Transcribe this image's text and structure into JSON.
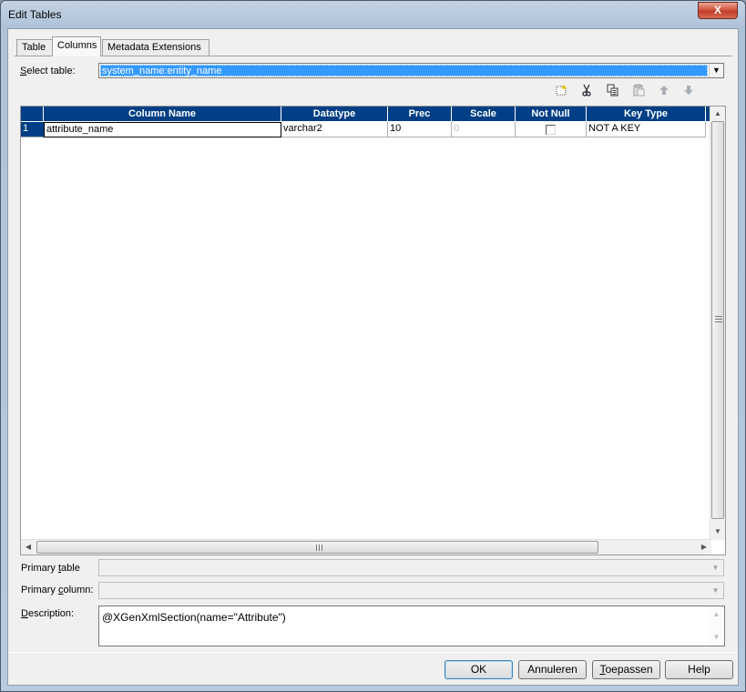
{
  "window": {
    "title": "Edit Tables",
    "close_label": "X"
  },
  "tabs": [
    {
      "label": "Table"
    },
    {
      "label": "Columns"
    },
    {
      "label": "Metadata Extensions"
    }
  ],
  "select_table": {
    "label_prefix": "S",
    "label_rest": "elect table:",
    "value": "system_name:entity_name"
  },
  "toolbar": {
    "icons": [
      "new-column-icon",
      "cut-icon",
      "copy-icon",
      "paste-icon",
      "move-up-icon",
      "move-down-icon"
    ]
  },
  "grid": {
    "columns": [
      "Column Name",
      "Datatype",
      "Prec",
      "Scale",
      "Not Null",
      "Key Type"
    ],
    "rows": [
      {
        "num": "1",
        "name": "attribute_name",
        "datatype": "varchar2",
        "prec": "10",
        "scale": "0",
        "not_null": false,
        "key_type": "NOT A KEY"
      }
    ],
    "header_color": "#003f85"
  },
  "fields": {
    "primary_table_label_a": "Primary ",
    "primary_table_label_u": "t",
    "primary_table_label_b": "able",
    "primary_column_label_a": "Primary ",
    "primary_column_label_u": "c",
    "primary_column_label_b": "olumn:",
    "description_label_u": "D",
    "description_label_b": "escription:",
    "description_value": "@XGenXmlSection(name=\"Attribute\")"
  },
  "buttons": {
    "ok": "OK",
    "cancel": "Annuleren",
    "apply_u": "T",
    "apply_rest": "oepassen",
    "help": "Help"
  }
}
